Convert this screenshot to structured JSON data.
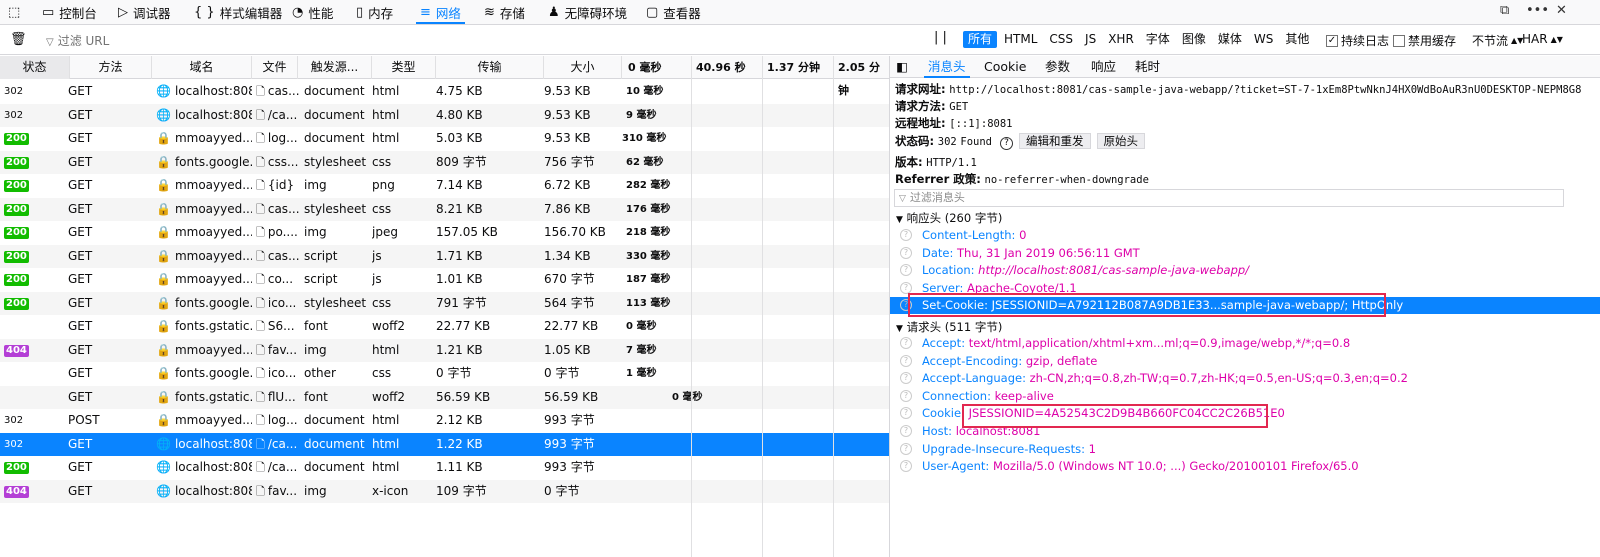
{
  "toolbar": {
    "tabs": [
      {
        "label": "控制台",
        "icon": "inspector-icon"
      },
      {
        "label": "控制台",
        "icon": "console-icon"
      },
      {
        "label": "调试器",
        "icon": "debugger-icon"
      },
      {
        "label": "样式编辑器",
        "icon": "style-editor-icon"
      },
      {
        "label": "性能",
        "icon": "performance-icon"
      },
      {
        "label": "内存",
        "icon": "memory-icon"
      },
      {
        "label": "网络",
        "icon": "network-icon"
      },
      {
        "label": "存储",
        "icon": "storage-icon"
      },
      {
        "label": "无障碍环境",
        "icon": "accessibility-icon"
      },
      {
        "label": "查看器",
        "icon": "viewer-icon"
      }
    ],
    "active_tab": "网络"
  },
  "filter": {
    "url_placeholder": "过滤 URL",
    "types": [
      "所有",
      "HTML",
      "CSS",
      "JS",
      "XHR",
      "字体",
      "图像",
      "媒体",
      "WS",
      "其他"
    ],
    "selected_type": "所有",
    "persist_log_label": "持续日志",
    "persist_log_checked": true,
    "disable_cache_label": "禁用缓存",
    "disable_cache_checked": false,
    "throttle_label": "不节流",
    "har_label": "HAR"
  },
  "columns": [
    "状态",
    "方法",
    "域名",
    "文件",
    "触发源...",
    "类型",
    "传输",
    "大小",
    "0 毫秒",
    "40.96 秒",
    "1.37 分钟",
    "2.05 分钟"
  ],
  "requests": [
    {
      "status": "302",
      "method": "GET",
      "secure": false,
      "domain": "localhost:8081",
      "file": "cas...",
      "cause": "document",
      "type": "html",
      "transferred": "4.75 KB",
      "size": "9.53 KB",
      "time": "10 毫秒"
    },
    {
      "status": "302",
      "method": "GET",
      "secure": false,
      "domain": "localhost:8081",
      "file": "/ca...",
      "cause": "document",
      "type": "html",
      "transferred": "4.80 KB",
      "size": "9.53 KB",
      "time": "9 毫秒"
    },
    {
      "status": "200",
      "method": "GET",
      "secure": true,
      "domain": "mmoayyed....",
      "file": "log...",
      "cause": "document",
      "type": "html",
      "transferred": "5.03 KB",
      "size": "9.53 KB",
      "time": "310 毫秒"
    },
    {
      "status": "200",
      "method": "GET",
      "secure": true,
      "domain": "fonts.google...",
      "file": "css...",
      "cause": "stylesheet",
      "type": "css",
      "transferred": "809 字节",
      "size": "756 字节",
      "time": "62 毫秒"
    },
    {
      "status": "200",
      "method": "GET",
      "secure": true,
      "domain": "mmoayyed....",
      "file": "{id}",
      "cause": "img",
      "type": "png",
      "transferred": "7.14 KB",
      "size": "6.72 KB",
      "time": "282 毫秒"
    },
    {
      "status": "200",
      "method": "GET",
      "secure": true,
      "domain": "mmoayyed....",
      "file": "cas...",
      "cause": "stylesheet",
      "type": "css",
      "transferred": "8.21 KB",
      "size": "7.86 KB",
      "time": "176 毫秒"
    },
    {
      "status": "200",
      "method": "GET",
      "secure": true,
      "domain": "mmoayyed....",
      "file": "po....",
      "cause": "img",
      "type": "jpeg",
      "transferred": "157.05 KB",
      "size": "156.70 KB",
      "time": "218 毫秒"
    },
    {
      "status": "200",
      "method": "GET",
      "secure": true,
      "domain": "mmoayyed....",
      "file": "cas...",
      "cause": "script",
      "type": "js",
      "transferred": "1.71 KB",
      "size": "1.34 KB",
      "time": "330 毫秒"
    },
    {
      "status": "200",
      "method": "GET",
      "secure": true,
      "domain": "mmoayyed....",
      "file": "co...",
      "cause": "script",
      "type": "js",
      "transferred": "1.01 KB",
      "size": "670 字节",
      "time": "187 毫秒"
    },
    {
      "status": "200",
      "method": "GET",
      "secure": true,
      "domain": "fonts.google...",
      "file": "ico...",
      "cause": "stylesheet",
      "type": "css",
      "transferred": "791 字节",
      "size": "564 字节",
      "time": "113 毫秒"
    },
    {
      "status": "",
      "method": "GET",
      "secure": true,
      "domain": "fonts.gstatic....",
      "file": "S6...",
      "cause": "font",
      "type": "woff2",
      "transferred": "22.77 KB",
      "size": "22.77 KB",
      "time": "0 毫秒"
    },
    {
      "status": "404",
      "method": "GET",
      "secure": true,
      "domain": "mmoayyed....",
      "file": "fav...",
      "cause": "img",
      "type": "html",
      "transferred": "1.21 KB",
      "size": "1.05 KB",
      "time": "7 毫秒"
    },
    {
      "status": "",
      "method": "GET",
      "secure": true,
      "domain": "fonts.google...",
      "file": "ico...",
      "cause": "other",
      "type": "css",
      "transferred": "0 字节",
      "size": "0 字节",
      "time": "1 毫秒"
    },
    {
      "status": "",
      "method": "GET",
      "secure": true,
      "domain": "fonts.gstatic....",
      "file": "flU...",
      "cause": "font",
      "type": "woff2",
      "transferred": "56.59 KB",
      "size": "56.59 KB",
      "time": "0 毫秒"
    },
    {
      "status": "302",
      "method": "POST",
      "secure": true,
      "domain": "mmoayyed....",
      "file": "log...",
      "cause": "document",
      "type": "html",
      "transferred": "2.12 KB",
      "size": "993 字节",
      "time": ""
    },
    {
      "status": "302",
      "method": "GET",
      "secure": false,
      "domain": "localhost:8081",
      "file": "/ca...",
      "cause": "document",
      "type": "html",
      "transferred": "1.22 KB",
      "size": "993 字节",
      "time": ""
    },
    {
      "status": "200",
      "method": "GET",
      "secure": false,
      "domain": "localhost:8081",
      "file": "/ca...",
      "cause": "document",
      "type": "html",
      "transferred": "1.11 KB",
      "size": "993 字节",
      "time": ""
    },
    {
      "status": "404",
      "method": "GET",
      "secure": false,
      "domain": "localhost:8081",
      "file": "fav...",
      "cause": "img",
      "type": "x-icon",
      "transferred": "109 字节",
      "size": "0 字节",
      "time": ""
    }
  ],
  "selected_request_index": 15,
  "details": {
    "tabs": [
      "消息头",
      "Cookie",
      "参数",
      "响应",
      "耗时"
    ],
    "active_tab": "消息头",
    "request_url_label": "请求网址:",
    "request_url": "http://localhost:8081/cas-sample-java-webapp/?ticket=ST-7-1xEm8PtwNknJ4HX0WdBoAuR3nU0DESKTOP-NEPM8G8",
    "method_label": "请求方法:",
    "method": "GET",
    "remote_label": "远程地址:",
    "remote": "[::1]:8081",
    "status_label": "状态码:",
    "status_code": "302",
    "status_text": "Found",
    "edit_resend": "编辑和重发",
    "raw_headers": "原始头",
    "version_label": "版本:",
    "version": "HTTP/1.1",
    "referrer_label": "Referrer 政策:",
    "referrer": "no-referrer-when-downgrade",
    "header_filter_placeholder": "过滤消息头",
    "response_section": "响应头 (260 字节)",
    "response_headers": [
      {
        "name": "Content-Length:",
        "value": "0"
      },
      {
        "name": "Date:",
        "value": "Thu, 31 Jan 2019 06:56:11 GMT"
      },
      {
        "name": "Location:",
        "value": "http://localhost:8081/cas-sample-java-webapp/"
      },
      {
        "name": "Server:",
        "value": "Apache-Coyote/1.1"
      },
      {
        "name": "Set-Cookie:",
        "value": "JSESSIONID=A792112B087A9DB1E33...sample-java-webapp/; HttpOnly"
      }
    ],
    "request_section": "请求头 (511 字节)",
    "request_headers": [
      {
        "name": "Accept:",
        "value": "text/html,application/xhtml+xm...ml;q=0.9,image/webp,*/*;q=0.8"
      },
      {
        "name": "Accept-Encoding:",
        "value": "gzip, deflate"
      },
      {
        "name": "Accept-Language:",
        "value": "zh-CN,zh;q=0.8,zh-TW;q=0.7,zh-HK;q=0.5,en-US;q=0.3,en;q=0.2"
      },
      {
        "name": "Connection:",
        "value": "keep-alive"
      },
      {
        "name": "Cookie:",
        "value": "JSESSIONID=4A52543C2D9B4B660FC04CC2C26B51E0"
      },
      {
        "name": "Host:",
        "value": "localhost:8081"
      },
      {
        "name": "Upgrade-Insecure-Requests:",
        "value": "1"
      },
      {
        "name": "User-Agent:",
        "value": "Mozilla/5.0 (Windows NT 10.0; ...) Gecko/20100101 Firefox/65.0"
      }
    ]
  },
  "colors": {
    "accent": "#0a84ff",
    "ok": "#12bc00",
    "not_found": "#b43fd6",
    "header_value": "#dd00a9",
    "highlight_box": "#e22850"
  }
}
